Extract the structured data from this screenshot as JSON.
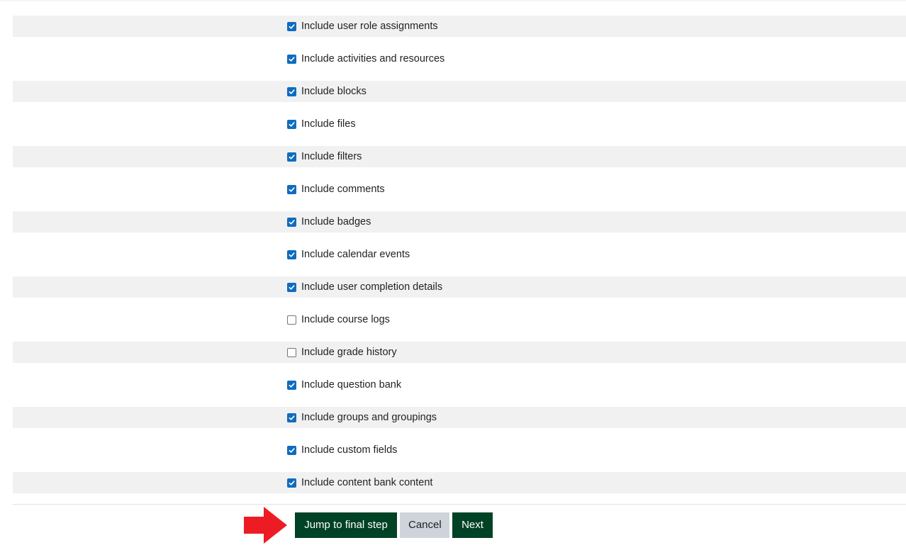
{
  "settings": {
    "items": [
      {
        "label": "Include user role assignments",
        "checked": true
      },
      {
        "label": "Include activities and resources",
        "checked": true
      },
      {
        "label": "Include blocks",
        "checked": true
      },
      {
        "label": "Include files",
        "checked": true
      },
      {
        "label": "Include filters",
        "checked": true
      },
      {
        "label": "Include comments",
        "checked": true
      },
      {
        "label": "Include badges",
        "checked": true
      },
      {
        "label": "Include calendar events",
        "checked": true
      },
      {
        "label": "Include user completion details",
        "checked": true
      },
      {
        "label": "Include course logs",
        "checked": false
      },
      {
        "label": "Include grade history",
        "checked": false
      },
      {
        "label": "Include question bank",
        "checked": true
      },
      {
        "label": "Include groups and groupings",
        "checked": true
      },
      {
        "label": "Include custom fields",
        "checked": true
      },
      {
        "label": "Include content bank content",
        "checked": true
      }
    ]
  },
  "actions": {
    "jump_label": "Jump to final step",
    "cancel_label": "Cancel",
    "next_label": "Next"
  },
  "annotation": {
    "icon": "red-arrow-right-icon",
    "color": "#ed1c24"
  },
  "colors": {
    "primary": "#004225",
    "secondary": "#ced4da",
    "checkbox": "#0f6cbf",
    "row_alt": "#f1f1f1"
  }
}
